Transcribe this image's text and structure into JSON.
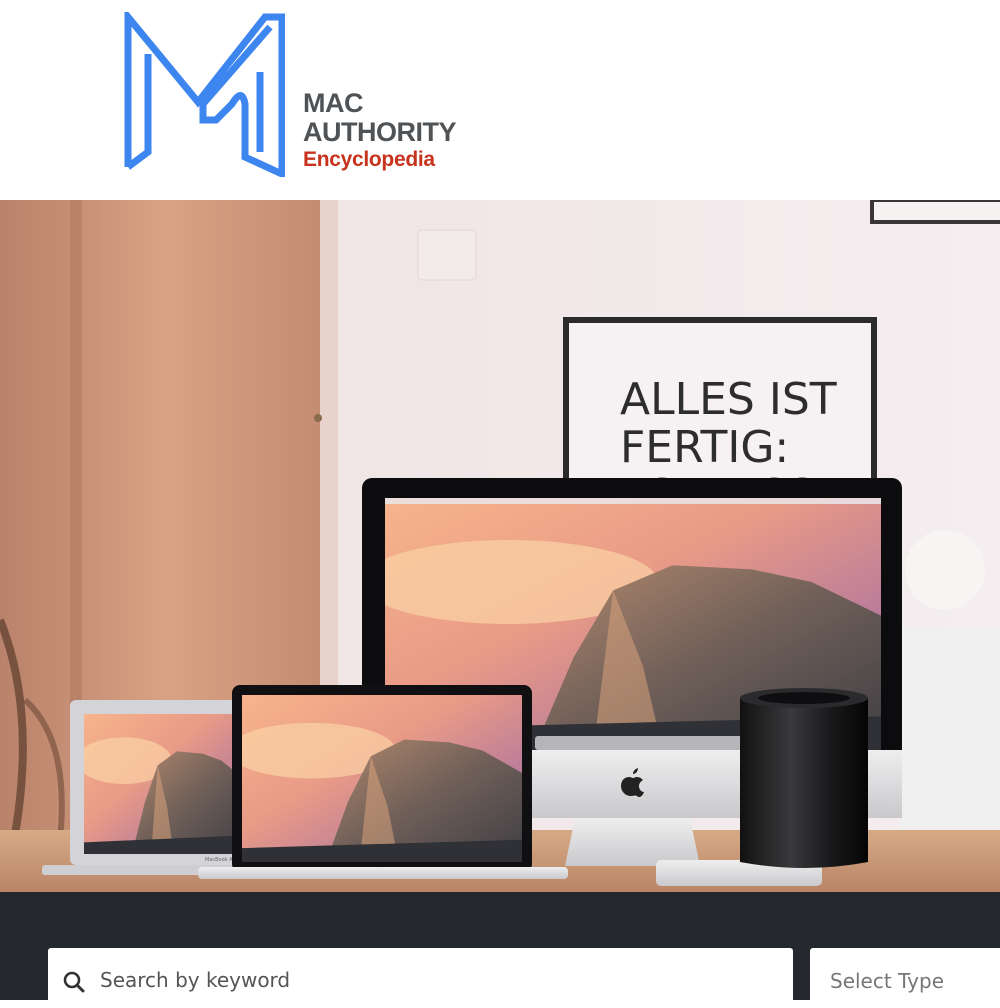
{
  "brand": {
    "logo_icon": "m-logo-icon",
    "line1": "MAC",
    "line2": "AUTHORITY",
    "line3": "Encyclopedia",
    "colors": {
      "mark": "#3d86f0",
      "text": "#4f5356",
      "accent": "#c7331d"
    }
  },
  "hero": {
    "poster_text": [
      "ALLES IST",
      "FERTIG:",
      "ES MUSS"
    ],
    "device_labels": {
      "macbook_air": "MacBook Air"
    }
  },
  "search": {
    "icon": "search-icon",
    "placeholder": "Search by keyword",
    "type_select": "Select Type"
  },
  "colors": {
    "search_bar_bg": "#25292f"
  }
}
